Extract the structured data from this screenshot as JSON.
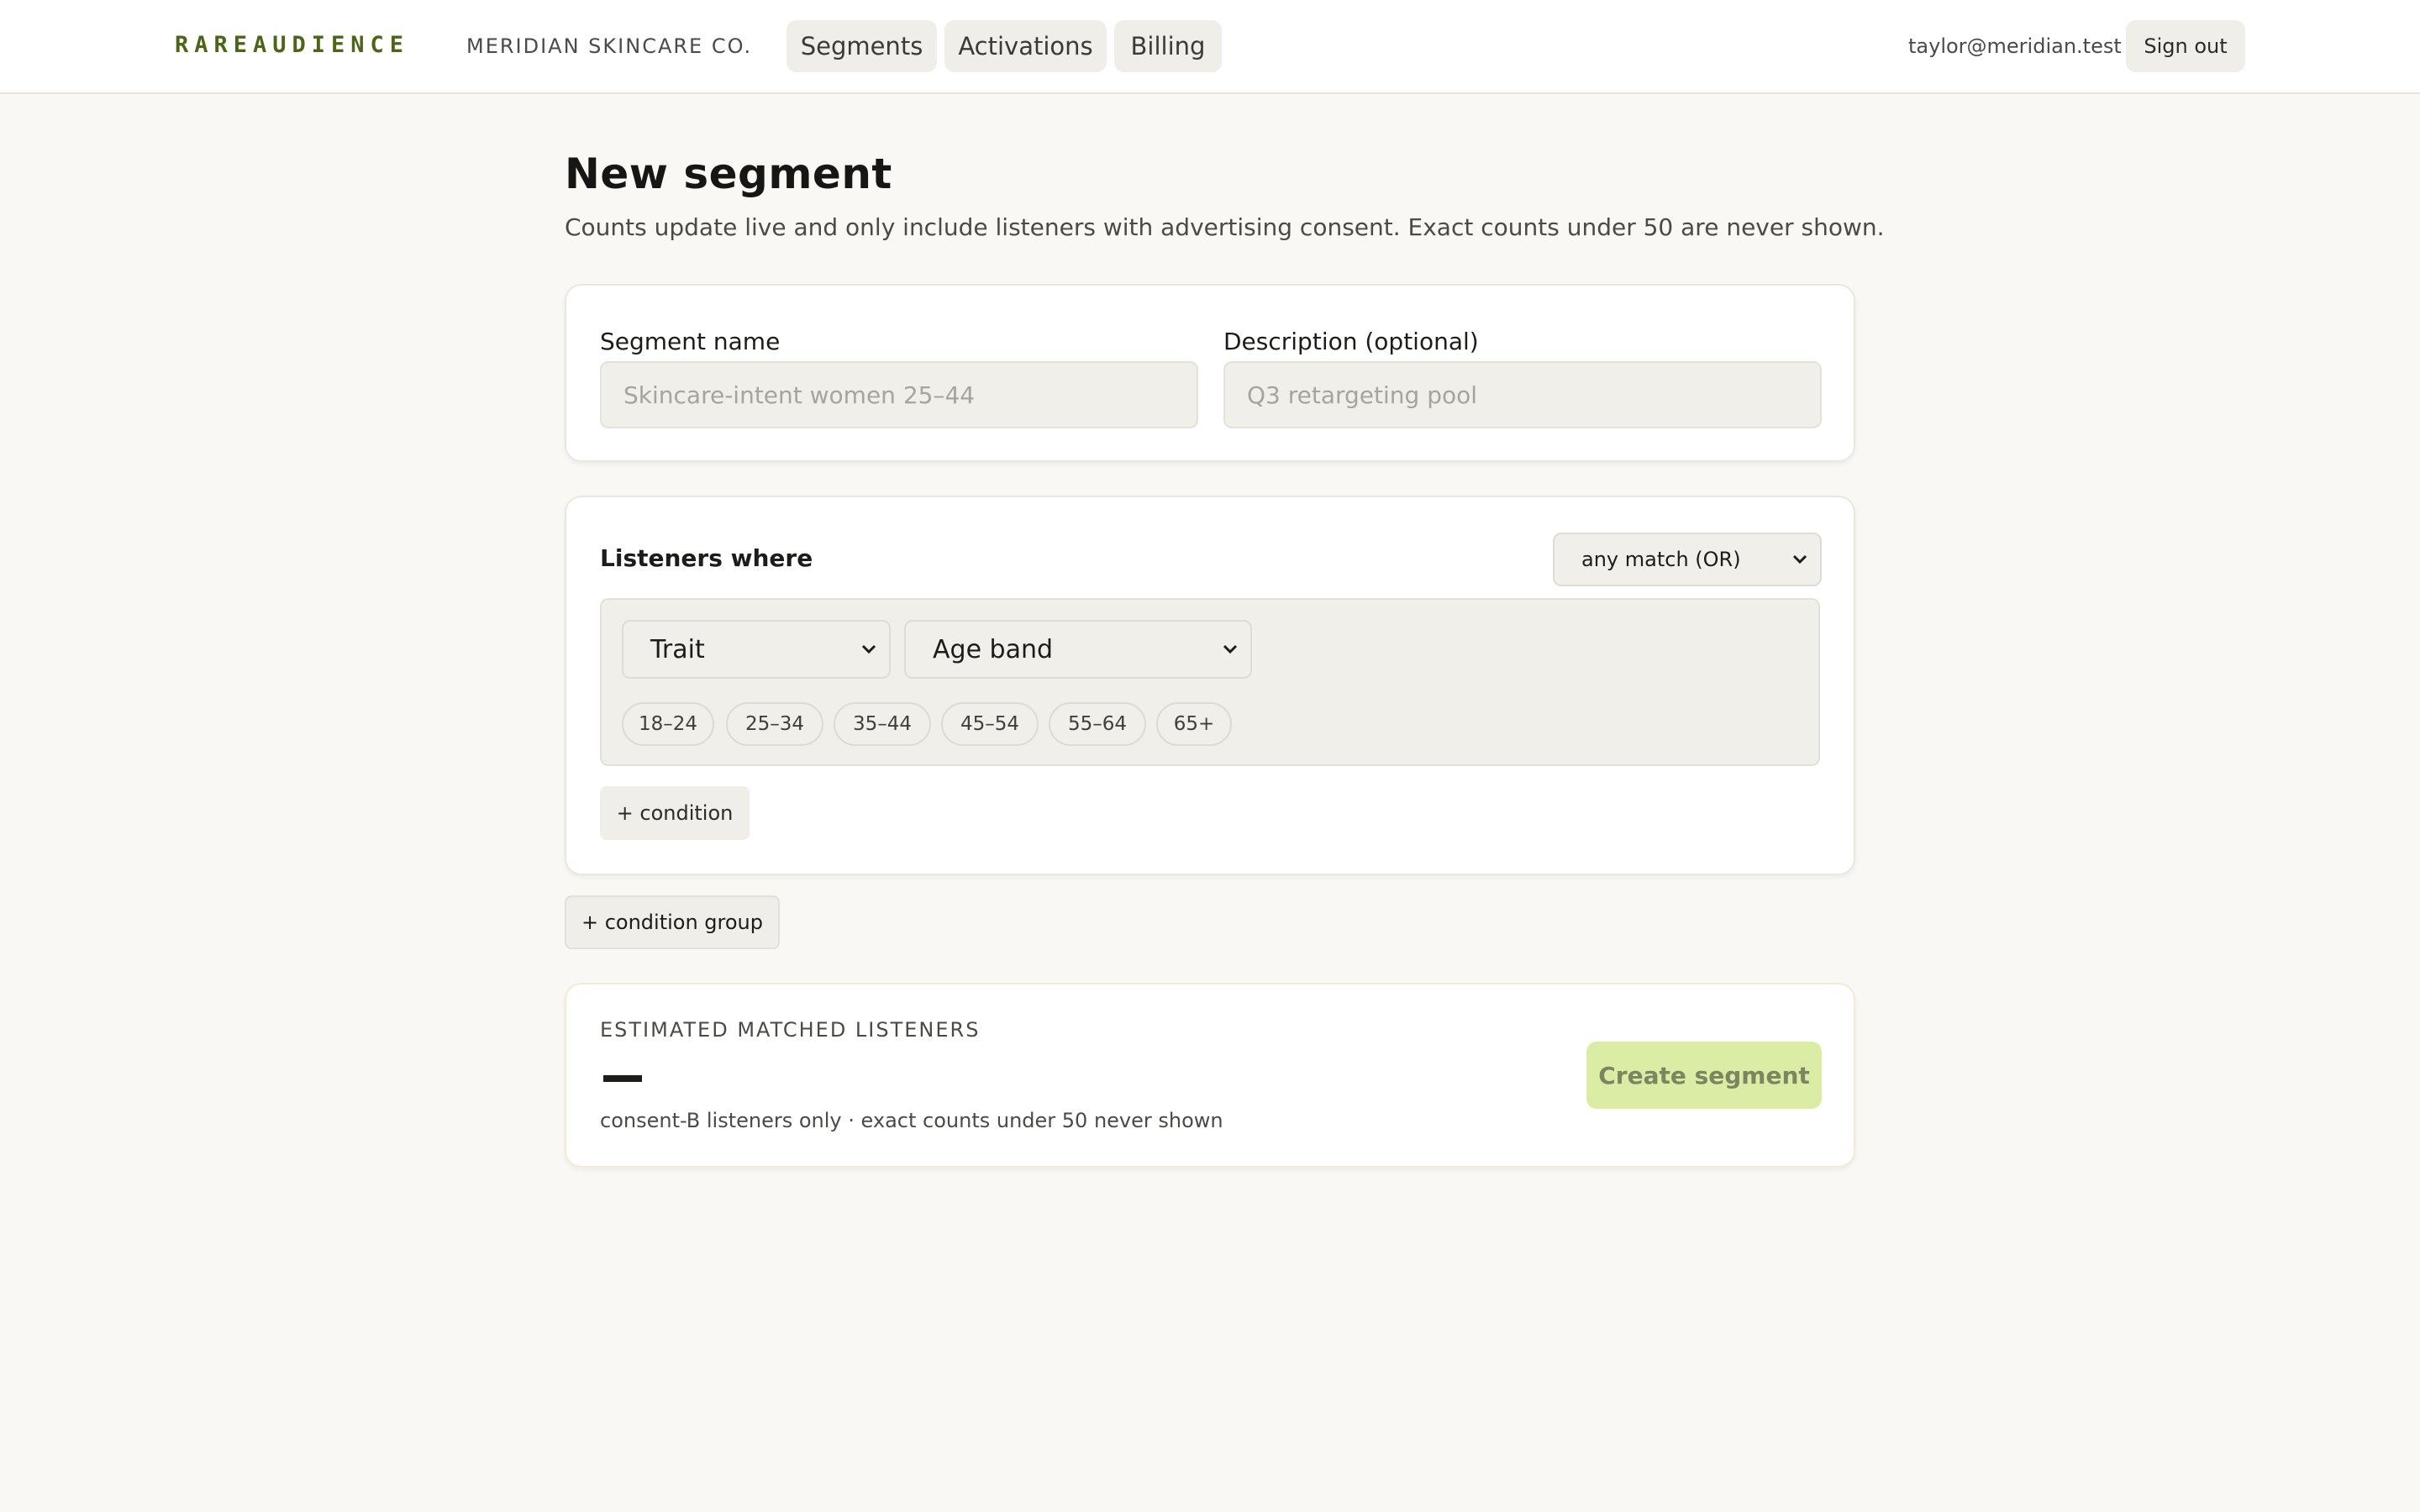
{
  "app": {
    "brand": "RAREAUDIENCE",
    "org": "MERIDIAN SKINCARE CO."
  },
  "nav": {
    "tabs": [
      {
        "label": "Segments"
      },
      {
        "label": "Activations"
      },
      {
        "label": "Billing"
      }
    ]
  },
  "user": {
    "email": "taylor@meridian.test",
    "sign_out_label": "Sign out"
  },
  "page": {
    "title": "New segment",
    "subtitle": "Counts update live and only include listeners with advertising consent. Exact counts under 50 are never shown."
  },
  "details": {
    "name_label": "Segment name",
    "name_value": "",
    "name_placeholder": "Skincare-intent women 25–44",
    "description_label": "Description (optional)",
    "description_value": "",
    "description_placeholder": "Q3 retargeting pool"
  },
  "builder": {
    "title": "Listeners where",
    "match_mode": "any match (OR)",
    "conditions": [
      {
        "field_type": "Trait",
        "trait": "Age band",
        "options": [
          "18–24",
          "25–34",
          "35–44",
          "45–54",
          "55–64",
          "65+"
        ]
      }
    ],
    "add_condition_label": "+ condition",
    "add_group_label": "+ condition group"
  },
  "estimate": {
    "label": "ESTIMATED MATCHED LISTENERS",
    "value": "—",
    "note": "consent-B listeners only · exact counts under 50 never shown",
    "create_label": "Create segment"
  },
  "colors": {
    "brand": "#4e6418",
    "page_background": "#f9f8f4",
    "surface_muted": "#efeee9",
    "create_button": "#dbeca4",
    "create_button_text": "#7c8560"
  },
  "icons": {
    "select_indicator": "chevron-down-icon"
  }
}
